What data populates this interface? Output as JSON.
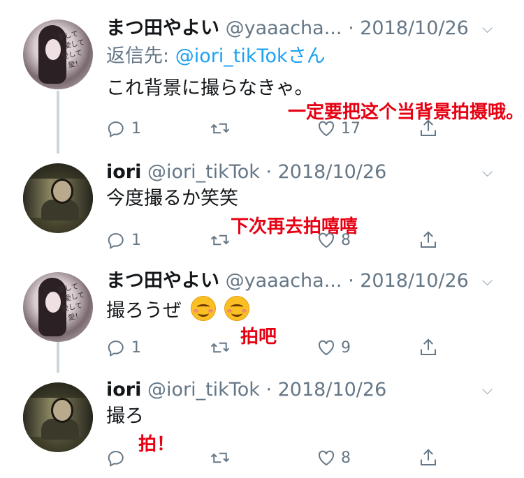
{
  "tweets": [
    {
      "name": "まつ田やよい",
      "handle": "@yaaacha...",
      "date": "· 2018/10/26",
      "reply_prefix": "返信先: ",
      "reply_to": "@iori_tikTokさん",
      "text": "これ背景に撮らなきゃ。",
      "replies": "1",
      "retweets": "",
      "likes": "17",
      "annotation": "一定要把这个当背景拍摄哦。",
      "avatar_scrawl": "愛して\n  愛して\n愛して\n  愛！"
    },
    {
      "name": "iori",
      "handle": "@iori_tikTok",
      "date": "· 2018/10/26",
      "text": "今度撮るか笑笑",
      "replies": "1",
      "retweets": "",
      "likes": "8",
      "annotation": "下次再去拍嘻嘻"
    },
    {
      "name": "まつ田やよい",
      "handle": "@yaaacha...",
      "date": "· 2018/10/26",
      "text": "撮ろうぜ",
      "emoji": "smiling-face-savoring-food",
      "replies": "1",
      "retweets": "",
      "likes": "9",
      "annotation": "拍吧",
      "avatar_scrawl": "愛して\n  愛して\n愛して\n  愛！"
    },
    {
      "name": "iori",
      "handle": "@iori_tikTok",
      "date": "· 2018/10/26",
      "text": "撮ろ",
      "replies": "",
      "retweets": "",
      "likes": "8",
      "annotation": "拍！"
    }
  ],
  "icons": {
    "reply": "reply-icon",
    "retweet": "retweet-icon",
    "like": "heart-icon",
    "share": "share-icon",
    "menu": "chevron-down-icon"
  },
  "colors": {
    "link": "#1da1f2",
    "muted": "#657786",
    "annotation": "#e60012"
  }
}
